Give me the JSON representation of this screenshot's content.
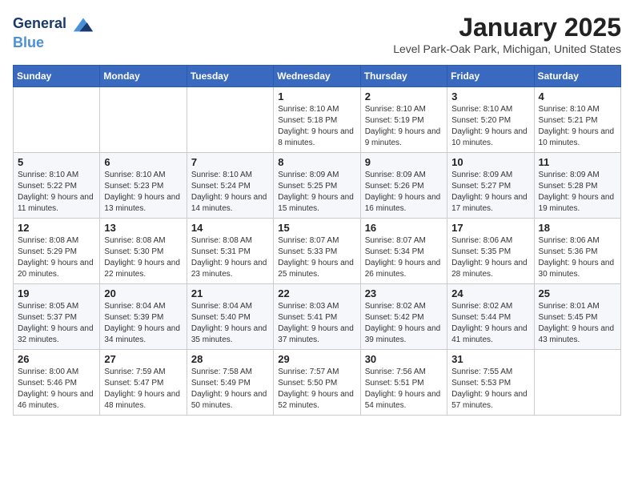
{
  "header": {
    "logo_line1": "General",
    "logo_line2": "Blue",
    "month_title": "January 2025",
    "location": "Level Park-Oak Park, Michigan, United States"
  },
  "weekdays": [
    "Sunday",
    "Monday",
    "Tuesday",
    "Wednesday",
    "Thursday",
    "Friday",
    "Saturday"
  ],
  "weeks": [
    [
      {
        "day": "",
        "info": ""
      },
      {
        "day": "",
        "info": ""
      },
      {
        "day": "",
        "info": ""
      },
      {
        "day": "1",
        "info": "Sunrise: 8:10 AM\nSunset: 5:18 PM\nDaylight: 9 hours and 8 minutes."
      },
      {
        "day": "2",
        "info": "Sunrise: 8:10 AM\nSunset: 5:19 PM\nDaylight: 9 hours and 9 minutes."
      },
      {
        "day": "3",
        "info": "Sunrise: 8:10 AM\nSunset: 5:20 PM\nDaylight: 9 hours and 10 minutes."
      },
      {
        "day": "4",
        "info": "Sunrise: 8:10 AM\nSunset: 5:21 PM\nDaylight: 9 hours and 10 minutes."
      }
    ],
    [
      {
        "day": "5",
        "info": "Sunrise: 8:10 AM\nSunset: 5:22 PM\nDaylight: 9 hours and 11 minutes."
      },
      {
        "day": "6",
        "info": "Sunrise: 8:10 AM\nSunset: 5:23 PM\nDaylight: 9 hours and 13 minutes."
      },
      {
        "day": "7",
        "info": "Sunrise: 8:10 AM\nSunset: 5:24 PM\nDaylight: 9 hours and 14 minutes."
      },
      {
        "day": "8",
        "info": "Sunrise: 8:09 AM\nSunset: 5:25 PM\nDaylight: 9 hours and 15 minutes."
      },
      {
        "day": "9",
        "info": "Sunrise: 8:09 AM\nSunset: 5:26 PM\nDaylight: 9 hours and 16 minutes."
      },
      {
        "day": "10",
        "info": "Sunrise: 8:09 AM\nSunset: 5:27 PM\nDaylight: 9 hours and 17 minutes."
      },
      {
        "day": "11",
        "info": "Sunrise: 8:09 AM\nSunset: 5:28 PM\nDaylight: 9 hours and 19 minutes."
      }
    ],
    [
      {
        "day": "12",
        "info": "Sunrise: 8:08 AM\nSunset: 5:29 PM\nDaylight: 9 hours and 20 minutes."
      },
      {
        "day": "13",
        "info": "Sunrise: 8:08 AM\nSunset: 5:30 PM\nDaylight: 9 hours and 22 minutes."
      },
      {
        "day": "14",
        "info": "Sunrise: 8:08 AM\nSunset: 5:31 PM\nDaylight: 9 hours and 23 minutes."
      },
      {
        "day": "15",
        "info": "Sunrise: 8:07 AM\nSunset: 5:33 PM\nDaylight: 9 hours and 25 minutes."
      },
      {
        "day": "16",
        "info": "Sunrise: 8:07 AM\nSunset: 5:34 PM\nDaylight: 9 hours and 26 minutes."
      },
      {
        "day": "17",
        "info": "Sunrise: 8:06 AM\nSunset: 5:35 PM\nDaylight: 9 hours and 28 minutes."
      },
      {
        "day": "18",
        "info": "Sunrise: 8:06 AM\nSunset: 5:36 PM\nDaylight: 9 hours and 30 minutes."
      }
    ],
    [
      {
        "day": "19",
        "info": "Sunrise: 8:05 AM\nSunset: 5:37 PM\nDaylight: 9 hours and 32 minutes."
      },
      {
        "day": "20",
        "info": "Sunrise: 8:04 AM\nSunset: 5:39 PM\nDaylight: 9 hours and 34 minutes."
      },
      {
        "day": "21",
        "info": "Sunrise: 8:04 AM\nSunset: 5:40 PM\nDaylight: 9 hours and 35 minutes."
      },
      {
        "day": "22",
        "info": "Sunrise: 8:03 AM\nSunset: 5:41 PM\nDaylight: 9 hours and 37 minutes."
      },
      {
        "day": "23",
        "info": "Sunrise: 8:02 AM\nSunset: 5:42 PM\nDaylight: 9 hours and 39 minutes."
      },
      {
        "day": "24",
        "info": "Sunrise: 8:02 AM\nSunset: 5:44 PM\nDaylight: 9 hours and 41 minutes."
      },
      {
        "day": "25",
        "info": "Sunrise: 8:01 AM\nSunset: 5:45 PM\nDaylight: 9 hours and 43 minutes."
      }
    ],
    [
      {
        "day": "26",
        "info": "Sunrise: 8:00 AM\nSunset: 5:46 PM\nDaylight: 9 hours and 46 minutes."
      },
      {
        "day": "27",
        "info": "Sunrise: 7:59 AM\nSunset: 5:47 PM\nDaylight: 9 hours and 48 minutes."
      },
      {
        "day": "28",
        "info": "Sunrise: 7:58 AM\nSunset: 5:49 PM\nDaylight: 9 hours and 50 minutes."
      },
      {
        "day": "29",
        "info": "Sunrise: 7:57 AM\nSunset: 5:50 PM\nDaylight: 9 hours and 52 minutes."
      },
      {
        "day": "30",
        "info": "Sunrise: 7:56 AM\nSunset: 5:51 PM\nDaylight: 9 hours and 54 minutes."
      },
      {
        "day": "31",
        "info": "Sunrise: 7:55 AM\nSunset: 5:53 PM\nDaylight: 9 hours and 57 minutes."
      },
      {
        "day": "",
        "info": ""
      }
    ]
  ]
}
